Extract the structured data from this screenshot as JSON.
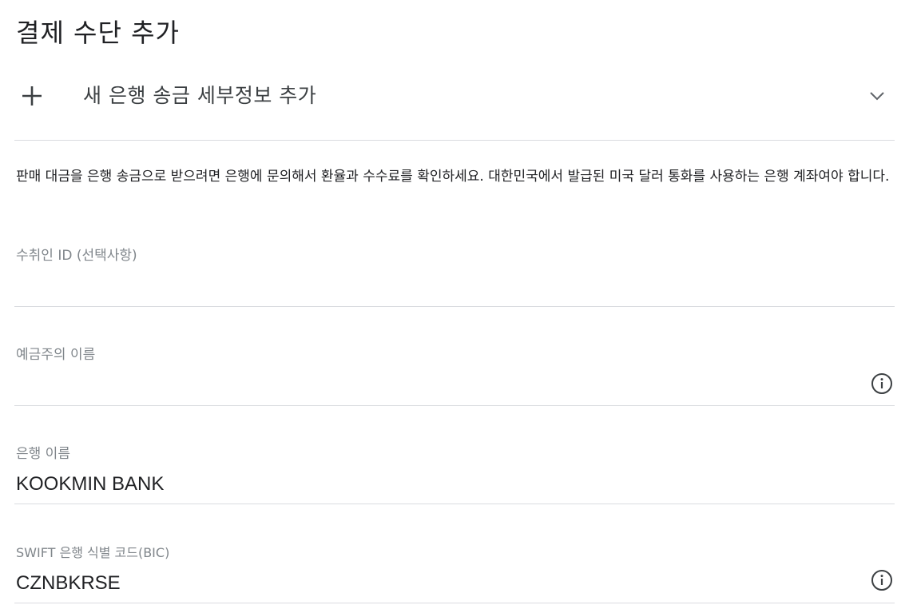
{
  "page": {
    "title": "결제 수단 추가"
  },
  "accordion": {
    "label": "새 은행 송금 세부정보 추가",
    "expand_icon": "plus-icon",
    "collapse_icon": "chevron-down-icon"
  },
  "description": "판매 대금을 은행 송금으로 받으려면 은행에 문의해서 환율과 수수료를 확인하세요. 대한민국에서 발급된 미국 달러 통화를 사용하는 은행 계좌여야 합니다.",
  "form": {
    "payee_id": {
      "label": "수취인 ID (선택사항)",
      "value": ""
    },
    "account_holder": {
      "label": "예금주의 이름",
      "value": "",
      "icon": "info-icon"
    },
    "bank_name": {
      "label": "은행 이름",
      "value": "KOOKMIN BANK"
    },
    "swift_code": {
      "label": "SWIFT 은행 식별 코드(BIC)",
      "value": "CZNBKRSE",
      "icon": "info-icon"
    }
  },
  "colors": {
    "text_primary": "#202124",
    "text_secondary": "#80868b",
    "divider": "#dadce0",
    "icon": "#5f6368"
  }
}
